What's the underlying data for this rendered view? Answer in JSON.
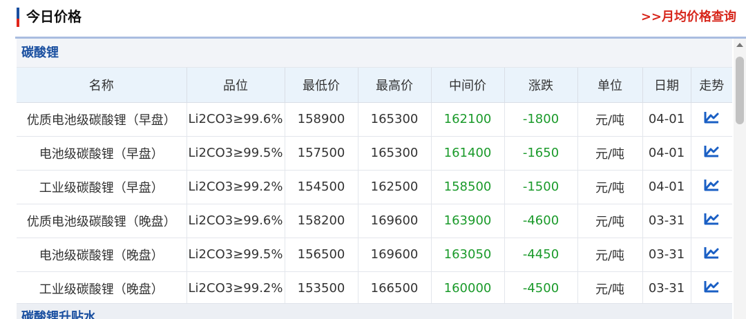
{
  "header": {
    "title": "今日价格",
    "month_link": ">>月均价格查询"
  },
  "section": {
    "title": "碳酸锂"
  },
  "next_section": {
    "title": "碳酸锂升贴水"
  },
  "columns": [
    "名称",
    "品位",
    "最低价",
    "最高价",
    "中间价",
    "涨跌",
    "单位",
    "日期",
    "走势"
  ],
  "rows": [
    {
      "name": "优质电池级碳酸锂（早盘）",
      "grade": "Li2CO3≥99.6%",
      "low": "158900",
      "high": "165300",
      "mid": "162100",
      "change": "-1800",
      "unit": "元/吨",
      "date": "04-01"
    },
    {
      "name": "电池级碳酸锂（早盘）",
      "grade": "Li2CO3≥99.5%",
      "low": "157500",
      "high": "165300",
      "mid": "161400",
      "change": "-1650",
      "unit": "元/吨",
      "date": "04-01"
    },
    {
      "name": "工业级碳酸锂（早盘）",
      "grade": "Li2CO3≥99.2%",
      "low": "154500",
      "high": "162500",
      "mid": "158500",
      "change": "-1500",
      "unit": "元/吨",
      "date": "04-01"
    },
    {
      "name": "优质电池级碳酸锂（晚盘）",
      "grade": "Li2CO3≥99.6%",
      "low": "158200",
      "high": "169600",
      "mid": "163900",
      "change": "-4600",
      "unit": "元/吨",
      "date": "03-31"
    },
    {
      "name": "电池级碳酸锂（晚盘）",
      "grade": "Li2CO3≥99.5%",
      "low": "156500",
      "high": "169600",
      "mid": "163050",
      "change": "-4450",
      "unit": "元/吨",
      "date": "03-31"
    },
    {
      "name": "工业级碳酸锂（晚盘）",
      "grade": "Li2CO3≥99.2%",
      "low": "153500",
      "high": "166500",
      "mid": "160000",
      "change": "-4500",
      "unit": "元/吨",
      "date": "03-31"
    }
  ],
  "colors": {
    "accent": "#1a4fa0",
    "link": "#d7261b",
    "price_down": "#1a9a2a"
  },
  "icons": {
    "trend": "trend-chart-icon"
  }
}
